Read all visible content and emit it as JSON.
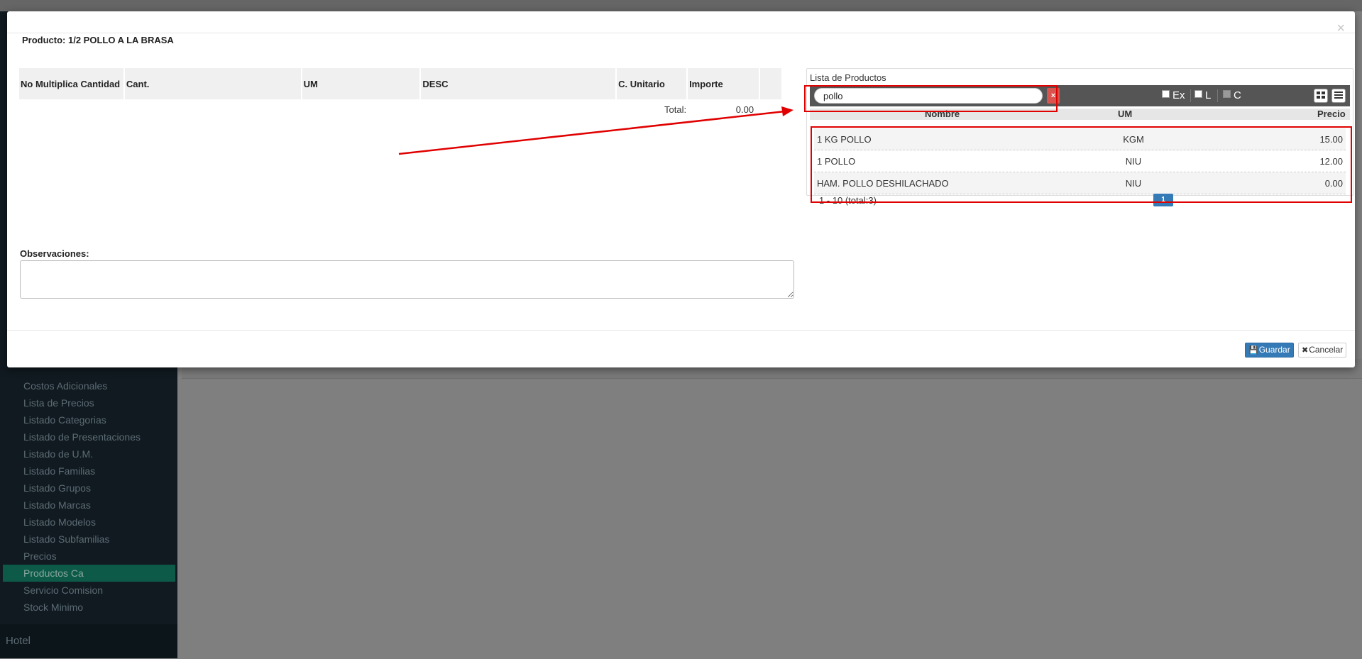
{
  "sidebar": {
    "items": [
      {
        "label": "Costos Adicionales"
      },
      {
        "label": "Lista de Precios"
      },
      {
        "label": "Listado Categorias"
      },
      {
        "label": "Listado de Presentaciones"
      },
      {
        "label": "Listado de U.M."
      },
      {
        "label": "Listado Familias"
      },
      {
        "label": "Listado Grupos"
      },
      {
        "label": "Listado Marcas"
      },
      {
        "label": "Listado Modelos"
      },
      {
        "label": "Listado Subfamilias"
      },
      {
        "label": "Precios"
      },
      {
        "label": "Productos Ca",
        "active": true
      },
      {
        "label": "Servicio Comision"
      },
      {
        "label": "Stock Minimo"
      }
    ],
    "section_label": "Hotel"
  },
  "modal": {
    "title": "Producto: 1/2 POLLO A LA BRASA",
    "close_glyph": "×",
    "table": {
      "headers": [
        "No Multiplica Cantidad",
        "Cant.",
        "UM",
        "DESC",
        "C. Unitario",
        "Importe",
        ""
      ],
      "total_label": "Total:",
      "total_value": "0.00"
    },
    "observations_label": "Observaciones:",
    "save_label": "Guardar",
    "cancel_label": "Cancelar"
  },
  "product_list": {
    "title": "Lista de Productos",
    "search_value": "pollo",
    "clear_glyph": "×",
    "filters": [
      {
        "label": "Ex",
        "checked": false
      },
      {
        "label": "L",
        "checked": false
      },
      {
        "label": "C",
        "checked": false,
        "disabled": true
      }
    ],
    "view_icons": [
      "grid-view-icon",
      "list-view-icon"
    ],
    "columns": {
      "name": "Nombre",
      "um": "UM",
      "price": "Precio"
    },
    "rows": [
      {
        "name": "1 KG POLLO",
        "um": "KGM",
        "price": "15.00"
      },
      {
        "name": "1 POLLO",
        "um": "NIU",
        "price": "12.00"
      },
      {
        "name": "HAM. POLLO DESHILACHADO",
        "um": "NIU",
        "price": "0.00"
      }
    ],
    "pager_info": "1 - 10 (total:3)",
    "page": "1"
  },
  "colors": {
    "annotation": "#e00000",
    "primary": "#337ab7",
    "danger": "#d9534f",
    "sidebar_active": "#0d5a49"
  }
}
